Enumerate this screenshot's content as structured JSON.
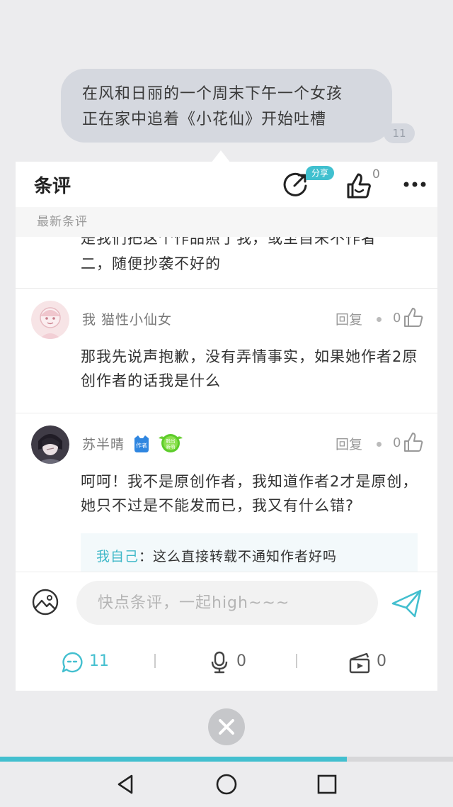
{
  "chat": {
    "bubble_text_line1": "在风和日丽的一个周末下午一个女孩",
    "bubble_text_line2": "正在家中追着《小花仙》开始吐槽",
    "count": "11"
  },
  "panel": {
    "title": "条评",
    "share_badge": "分享",
    "like_count": "0",
    "section_label": "最新条评"
  },
  "comments_cut_text_line1": "是我们把这个作品照了我，或至自来不作者",
  "comments_cut_text_line2": "二，随便抄袭不好的",
  "comments": [
    {
      "author": "我 猫性小仙女",
      "reply": "回复",
      "likes": "0",
      "text": "那我先说声抱歉，没有弄情事实，如果她作者2原创作者的话我是什么"
    },
    {
      "author": "苏半晴",
      "author_badge": "作者",
      "level_badge": "脱出新萌",
      "reply": "回复",
      "likes": "0",
      "text": "呵呵！我不是原创作者，我知道作者2才是原创，她只不过是不能发而已，我又有什么错?",
      "quote_name": "我自己",
      "quote_text": "：这么直接转载不通知作者好吗"
    }
  ],
  "input": {
    "placeholder": "快点条评，一起high~~~"
  },
  "tabs": {
    "comments_count": "11",
    "voice_count": "0",
    "video_count": "0"
  },
  "progress": {
    "fraction": 0.765
  },
  "colors": {
    "accent": "#43bfcf",
    "background": "#ececee"
  },
  "icons": [
    "share-icon",
    "like-icon",
    "more-icon",
    "image-icon",
    "send-icon",
    "comment-icon",
    "mic-icon",
    "clapper-icon",
    "close-icon"
  ]
}
